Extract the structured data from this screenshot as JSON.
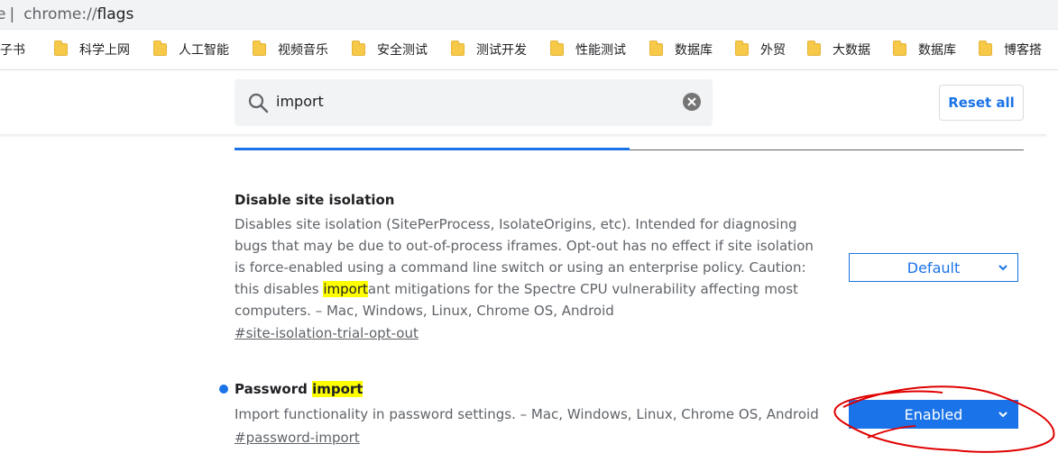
{
  "omnibox": {
    "left_fragment": "e",
    "separator": "|",
    "scheme": "chrome://",
    "path": "flags"
  },
  "bookmarks": [
    {
      "label": "电子书",
      "icon": "folder-icon"
    },
    {
      "label": "科学上网",
      "icon": "folder-icon"
    },
    {
      "label": "人工智能",
      "icon": "folder-icon"
    },
    {
      "label": "视频音乐",
      "icon": "folder-icon"
    },
    {
      "label": "安全测试",
      "icon": "folder-icon"
    },
    {
      "label": "测试开发",
      "icon": "folder-icon"
    },
    {
      "label": "性能测试",
      "icon": "folder-icon"
    },
    {
      "label": "数据库",
      "icon": "folder-icon"
    },
    {
      "label": "外贸",
      "icon": "folder-icon"
    },
    {
      "label": "大数据",
      "icon": "folder-icon"
    },
    {
      "label": "数据库",
      "icon": "folder-icon"
    },
    {
      "label": "博客搭",
      "icon": "folder-icon"
    }
  ],
  "search": {
    "value": "import",
    "icon": "search-icon",
    "clear_icon": "clear-icon"
  },
  "header": {
    "reset_label": "Reset all"
  },
  "experiments": [
    {
      "title": "Disable site isolation",
      "desc_before": "Disables site isolation (SitePerProcess, IsolateOrigins, etc). Intended for diagnosing bugs that may be due to out-of-process iframes. Opt-out has no effect if site isolation is force-enabled using a command line switch or using an enterprise policy. Caution: this disables ",
      "desc_highlight": "import",
      "desc_after": "ant mitigations for the Spectre CPU vulnerability affecting most computers. – Mac, Windows, Linux, Chrome OS, Android",
      "link": "#site-isolation-trial-opt-out",
      "select_value": "Default"
    },
    {
      "title_before": "Password ",
      "title_highlight": "import",
      "desc": "Import functionality in password settings. – Mac, Windows, Linux, Chrome OS, Android",
      "link": "#password-import",
      "select_value": "Enabled",
      "modified_indicator": true
    }
  ],
  "colors": {
    "accent": "#1a73e8",
    "highlight": "#ffff00",
    "annotation": "#e00000"
  }
}
